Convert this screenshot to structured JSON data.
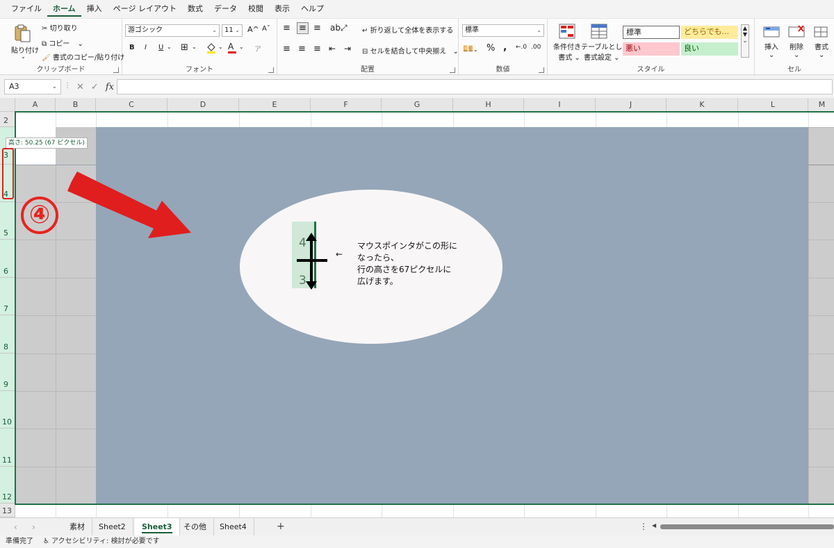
{
  "menu": {
    "tabs": [
      {
        "label": "ファイル"
      },
      {
        "label": "ホーム",
        "active": true
      },
      {
        "label": "挿入"
      },
      {
        "label": "ページ レイアウト"
      },
      {
        "label": "数式"
      },
      {
        "label": "データ"
      },
      {
        "label": "校閲"
      },
      {
        "label": "表示"
      },
      {
        "label": "ヘルプ"
      }
    ]
  },
  "ribbon": {
    "clipboard": {
      "paste_label": "貼り付け",
      "cut_label": "切り取り",
      "copy_label": "コピー",
      "format_painter_label": "書式のコピー/貼り付け",
      "group_label": "クリップボード"
    },
    "font": {
      "font_name": "游ゴシック",
      "font_size": "11",
      "grow_label": "A^",
      "shrink_label": "Aˇ",
      "bold_label": "B",
      "italic_label": "I",
      "underline_label": "U",
      "group_label": "フォント",
      "highlight_color": "#ffe400",
      "font_color": "#e01e1e"
    },
    "alignment": {
      "wrap_label": "折り返して全体を表示する",
      "merge_label": "セルを結合して中央揃え",
      "group_label": "配置"
    },
    "number": {
      "format": "標準",
      "percent_label": "%",
      "comma_label": ",",
      "group_label": "数値"
    },
    "styles": {
      "conditional_label_1": "条件付き",
      "conditional_label_2": "書式",
      "table_label_1": "テーブルとして",
      "table_label_2": "書式設定",
      "normal": "標準",
      "neutral": "どちらでも...",
      "bad": "悪い",
      "good": "良い",
      "group_label": "スタイル"
    },
    "cells": {
      "insert_label": "挿入",
      "delete_label": "削除",
      "format_label": "書式",
      "group_label": "セル"
    }
  },
  "formula_bar": {
    "name_box": "A3",
    "fx": "fx",
    "cancel": "✕",
    "enter": "✓"
  },
  "grid": {
    "columns": [
      "A",
      "B",
      "C",
      "D",
      "E",
      "F",
      "G",
      "H",
      "I",
      "J",
      "K",
      "L",
      "M"
    ],
    "rows": [
      "2",
      "3",
      "4",
      "5",
      "6",
      "7",
      "8",
      "9",
      "10",
      "11",
      "12",
      "13"
    ],
    "row_height_tooltip": "高さ: 50.25 (67 ピクセル)"
  },
  "annotation": {
    "step_number": "④",
    "pointer_top_num": "4",
    "pointer_bottom_num": "3",
    "text_lines": [
      "マウスポインタがこの形に",
      "なったら、",
      "行の高さを67ピクセルに",
      "広げます。"
    ],
    "small_arrow": "←",
    "accent_color": "#e01e1e"
  },
  "sheets": {
    "tabs": [
      {
        "label": "素材"
      },
      {
        "label": "Sheet2"
      },
      {
        "label": "Sheet3",
        "active": true
      },
      {
        "label": "その他"
      },
      {
        "label": "Sheet4"
      }
    ],
    "add_label": "+"
  },
  "status": {
    "ready": "準備完了",
    "accessibility": "アクセシビリティ: 検討が必要です"
  }
}
